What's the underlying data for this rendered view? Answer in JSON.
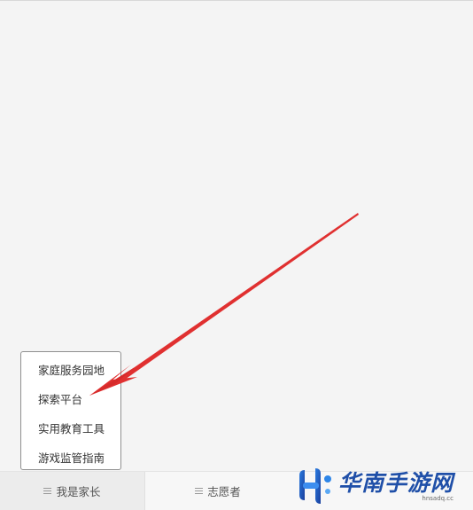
{
  "menu": {
    "items": [
      {
        "label": "家庭服务园地"
      },
      {
        "label": "探索平台"
      },
      {
        "label": "实用教育工具"
      },
      {
        "label": "游戏监管指南"
      }
    ]
  },
  "bottom_nav": {
    "tabs": [
      {
        "label": "我是家长",
        "icon": "menu-icon"
      },
      {
        "label": "志愿者",
        "icon": "menu-icon"
      }
    ]
  },
  "annotation": {
    "arrow_color": "#e03030"
  },
  "watermark": {
    "title": "华南手游网",
    "domain": "hnsadq.cc",
    "brand_color": "#1f4fa8"
  }
}
